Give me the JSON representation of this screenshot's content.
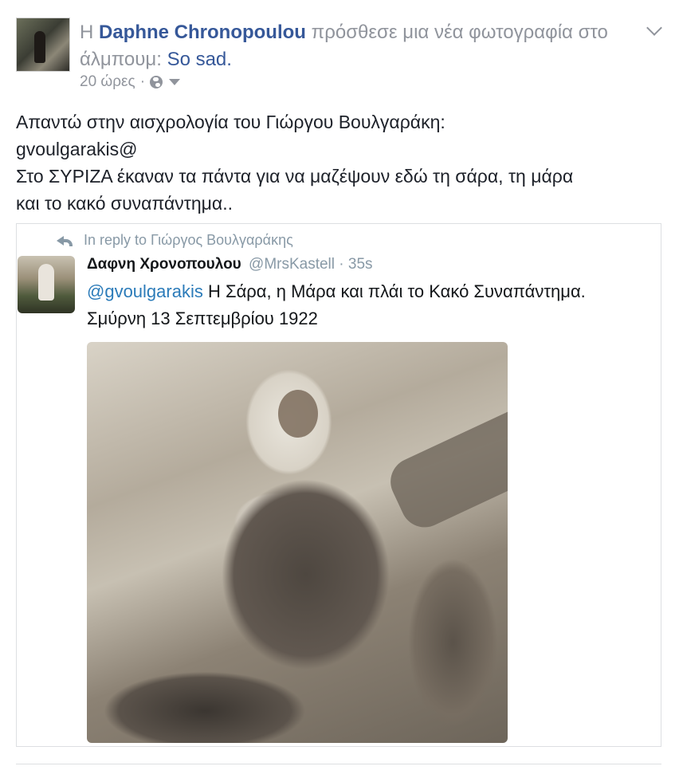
{
  "post": {
    "prefix": "Η ",
    "author": "Daphne Chronopoulou",
    "action": " πρόσθεσε μια νέα φωτογραφία στο άλμπουμ: ",
    "album": "So sad.",
    "time": "20 ώρες",
    "separator": "·",
    "privacy_icon": "globe-icon",
    "text_lines": [
      "Απαντώ στην αισχρολογία του Γιώργου Βουλγαράκη:",
      "gvoulgarakis@",
      "Στο ΣΥΡΙΖΑ έκαναν τα πάντα για να μαζέψουν εδώ τη σάρα, τη μάρα",
      "και το κακό συναπάντημα.."
    ]
  },
  "tweet": {
    "reply_to": "In reply to Γιώργος Βουλγαράκης",
    "author": "Δαφνη Χρονοπουλου",
    "handle": "@MrsKastell",
    "separator": "·",
    "time": "35s",
    "mention": "@gvoulgarakis",
    "text": " Η Σάρα, η Μάρα και πλάι το Κακό Συναπάντημα.",
    "text_line2": "Σμύρνη 13 Σεπτεμβρίου 1922"
  },
  "colors": {
    "link": "#365899",
    "muted": "#90949c",
    "twitter_link": "#2b7bb9"
  }
}
